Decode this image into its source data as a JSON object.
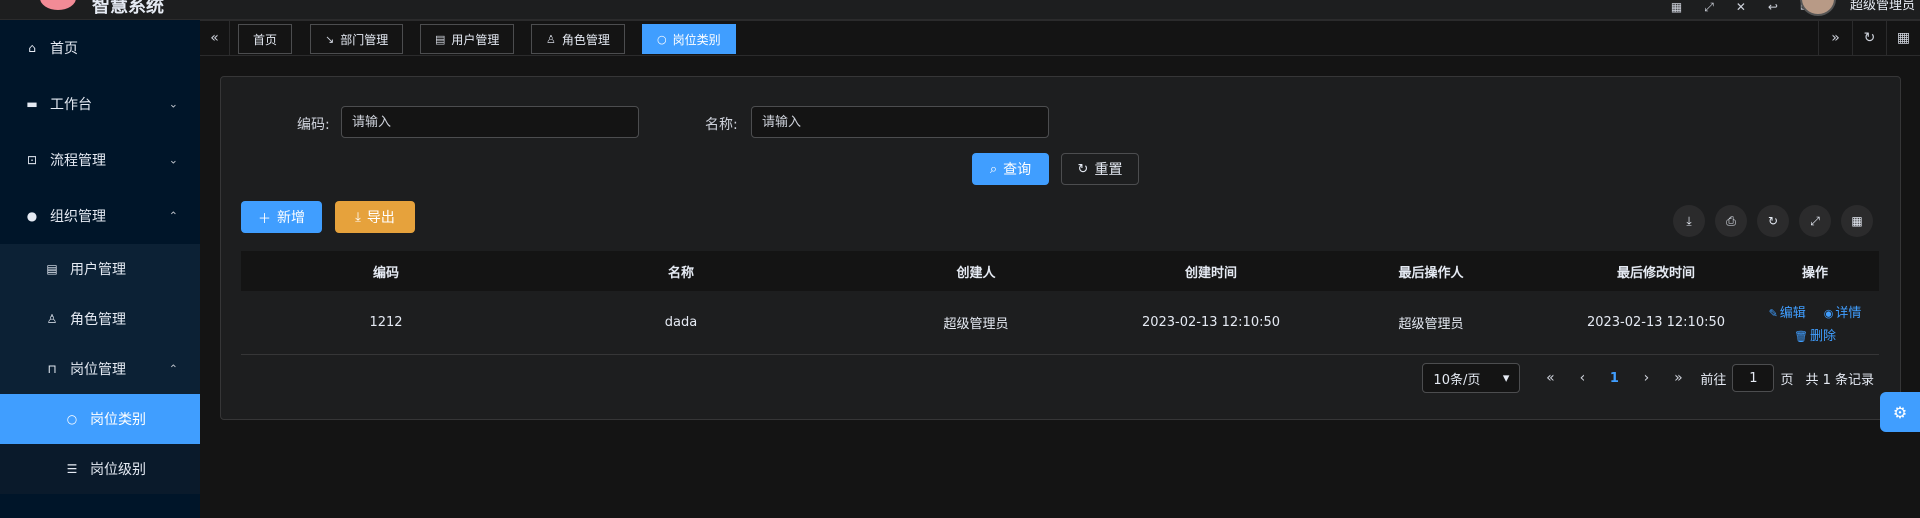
{
  "header": {
    "app_name": "智慧系统",
    "user_name": "超级管理员",
    "icons": [
      "grid-icon",
      "expand-icon",
      "close-icon",
      "back-icon",
      "message-icon"
    ]
  },
  "sidebar": {
    "items": [
      {
        "label": "首页",
        "icon": "home-icon"
      },
      {
        "label": "工作台",
        "icon": "monitor-icon",
        "expanded": false
      },
      {
        "label": "流程管理",
        "icon": "flow-icon",
        "expanded": false
      },
      {
        "label": "组织管理",
        "icon": "user-icon",
        "expanded": true
      }
    ],
    "org_children": [
      {
        "label": "用户管理",
        "icon": "notebook-icon"
      },
      {
        "label": "角色管理",
        "icon": "user-outline-icon"
      },
      {
        "label": "岗位管理",
        "icon": "board-icon",
        "expanded": true
      }
    ],
    "post_children": [
      {
        "label": "岗位类别",
        "icon": "apple-icon",
        "active": true
      },
      {
        "label": "岗位级别",
        "icon": "coin-icon",
        "active": false
      }
    ]
  },
  "tabs": [
    {
      "label": "首页",
      "icon": ""
    },
    {
      "label": "部门管理",
      "icon": "arrow-icon"
    },
    {
      "label": "用户管理",
      "icon": "notebook-icon"
    },
    {
      "label": "角色管理",
      "icon": "user-outline-icon"
    },
    {
      "label": "岗位类别",
      "icon": "apple-icon",
      "active": true
    }
  ],
  "search": {
    "code_label": "编码:",
    "code_placeholder": "请输入",
    "name_label": "名称:",
    "name_placeholder": "请输入",
    "query_label": "查询",
    "reset_label": "重置"
  },
  "toolbar": {
    "add_label": "新增",
    "export_label": "导出"
  },
  "table": {
    "columns": [
      "编码",
      "名称",
      "创建人",
      "创建时间",
      "最后操作人",
      "最后修改时间",
      "操作"
    ],
    "rows": [
      {
        "code": "1212",
        "name": "dada",
        "creator": "超级管理员",
        "created_at": "2023-02-13 12:10:50",
        "last_operator": "超级管理员",
        "updated_at": "2023-02-13 12:10:50"
      }
    ],
    "actions": {
      "edit": "编辑",
      "detail": "详情",
      "delete": "删除"
    }
  },
  "pagination": {
    "page_size": "10条/页",
    "current_page": "1",
    "goto_label": "前往",
    "goto_value": "1",
    "page_unit": "页",
    "total_text": "共 1 条记录"
  },
  "colors": {
    "primary": "#409eff",
    "warning": "#e6a23c",
    "sidebar_bg": "#001529",
    "page_bg": "#141414"
  }
}
